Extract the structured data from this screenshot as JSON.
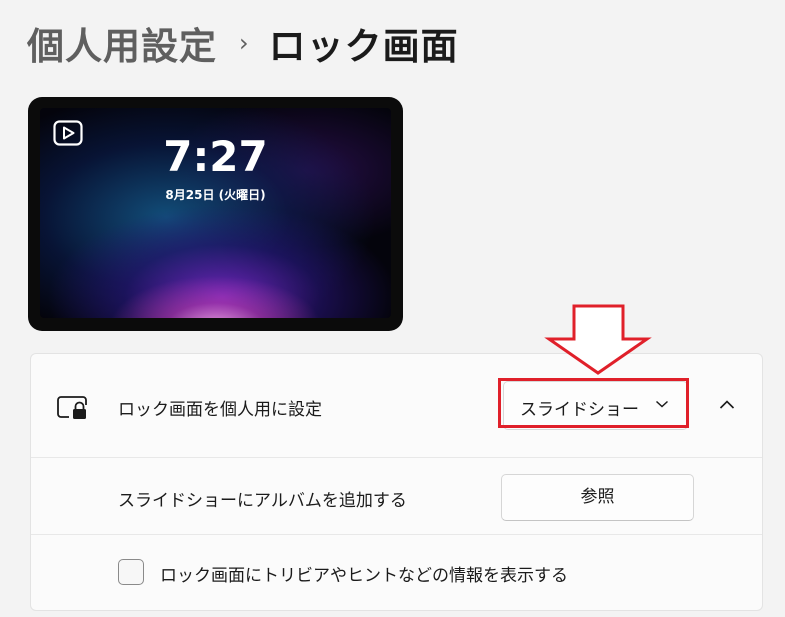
{
  "breadcrumb": {
    "parent": "個人用設定",
    "separator": "›",
    "current": "ロック画面"
  },
  "preview": {
    "time": "7:27",
    "date": "8月25日 (火曜日)",
    "icon": "play-icon"
  },
  "settings": {
    "personalize": {
      "label": "ロック画面を個人用に設定",
      "icon": "lock-screen-icon",
      "dropdown_value": "スライドショー",
      "expanded": true
    },
    "album": {
      "label": "スライドショーにアルバムを追加する",
      "button_label": "参照"
    },
    "trivia": {
      "label": "ロック画面にトリビアやヒントなどの情報を表示する",
      "checked": false
    }
  },
  "annotation": {
    "color": "#e0202a",
    "shape": "down-arrow-outline"
  }
}
